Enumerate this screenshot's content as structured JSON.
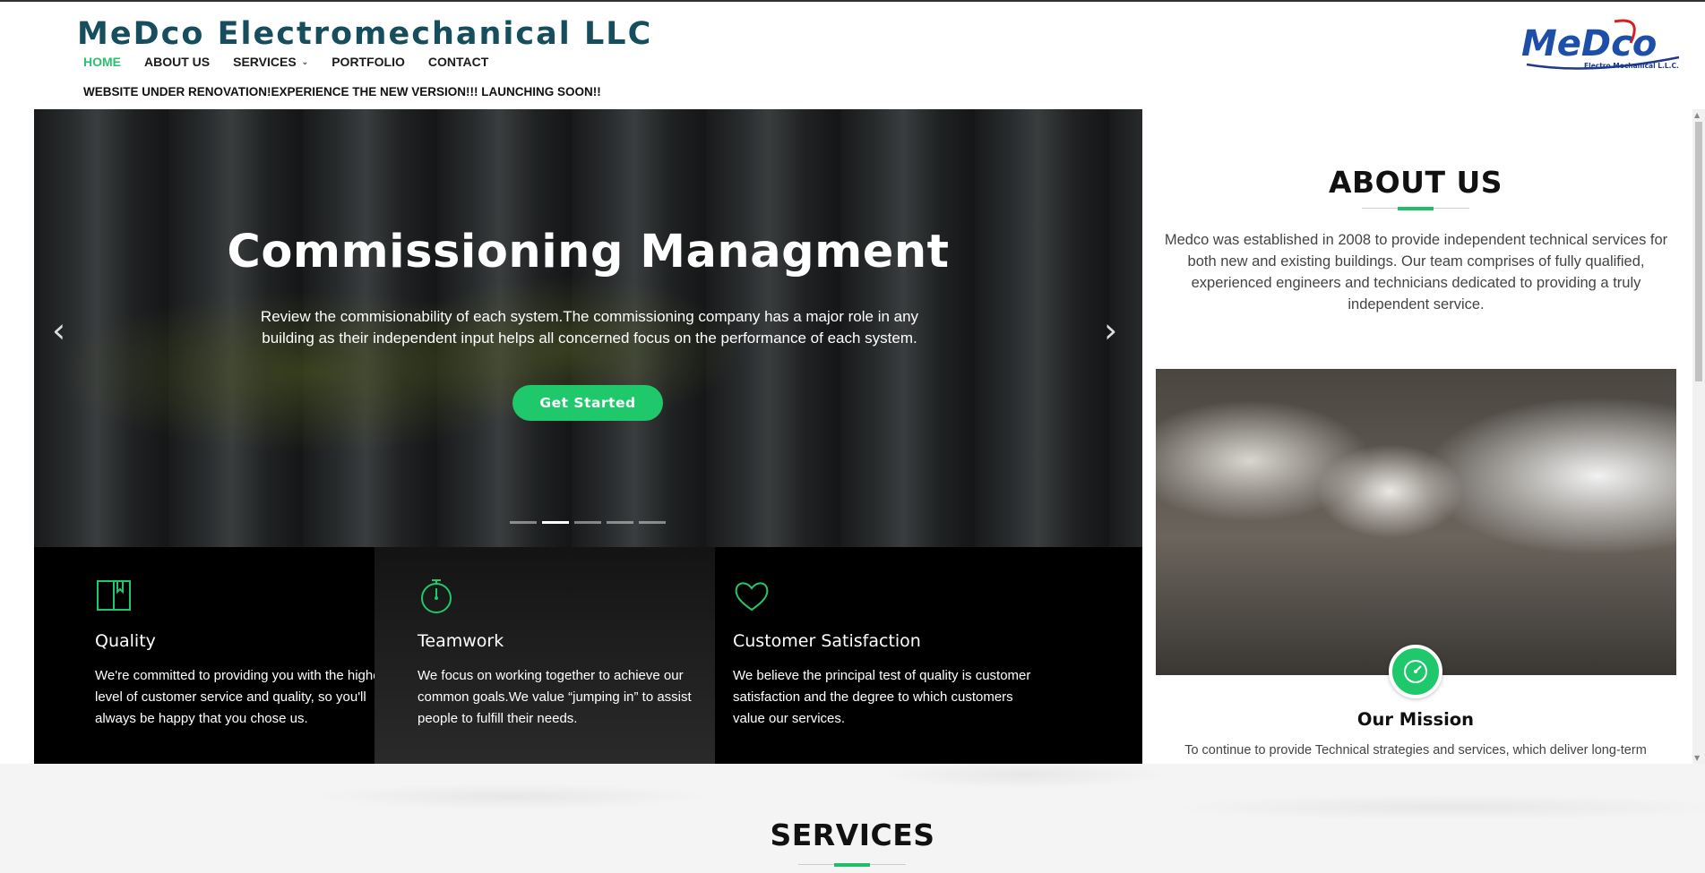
{
  "header": {
    "brand": "MeDco Electromechanical LLC",
    "notice": "WEBSITE UNDER RENOVATION!EXPERIENCE THE NEW VERSION!!! LAUNCHING SOON!!",
    "nav": [
      {
        "label": "HOME"
      },
      {
        "label": "ABOUT US"
      },
      {
        "label": "SERVICES"
      },
      {
        "label": "PORTFOLIO"
      },
      {
        "label": "CONTACT"
      }
    ],
    "logo": {
      "word": "MeDco",
      "tagline": "Electro Mechanical L.L.C."
    }
  },
  "hero": {
    "title": "Commissioning Managment",
    "text": "Review the commisionability of each system.The commissioning company has a major role in any building as their independent input helps all concerned focus on the performance of each system.",
    "button": "Get Started",
    "slide_count": 5,
    "active_slide": 2
  },
  "features": [
    {
      "icon": "book-icon",
      "title": "Quality",
      "text": "We're committed to providing you with the highest level of customer service and quality, so you'll always be happy that you chose us."
    },
    {
      "icon": "stopwatch-icon",
      "title": "Teamwork",
      "text": "We focus on working together to achieve our common goals.We value “jumping in” to assist people to fulfill their needs."
    },
    {
      "icon": "heart-icon",
      "title": "Customer Satisfaction",
      "text": "We believe the principal test of quality is customer satisfaction and the degree to which customers value our services."
    }
  ],
  "about": {
    "title": "ABOUT US",
    "text": "Medco was established in 2008 to provide independent technical services for both new and existing buildings. Our team comprises of fully qualified, experienced engineers and technicians dedicated to providing a truly independent service.",
    "mission_title": "Our Mission",
    "mission_text": "To continue to provide Technical strategies and services, which deliver long-term"
  },
  "services": {
    "title": "SERVICES"
  },
  "colors": {
    "accent": "#1fc96b",
    "brand": "#164e5e"
  }
}
